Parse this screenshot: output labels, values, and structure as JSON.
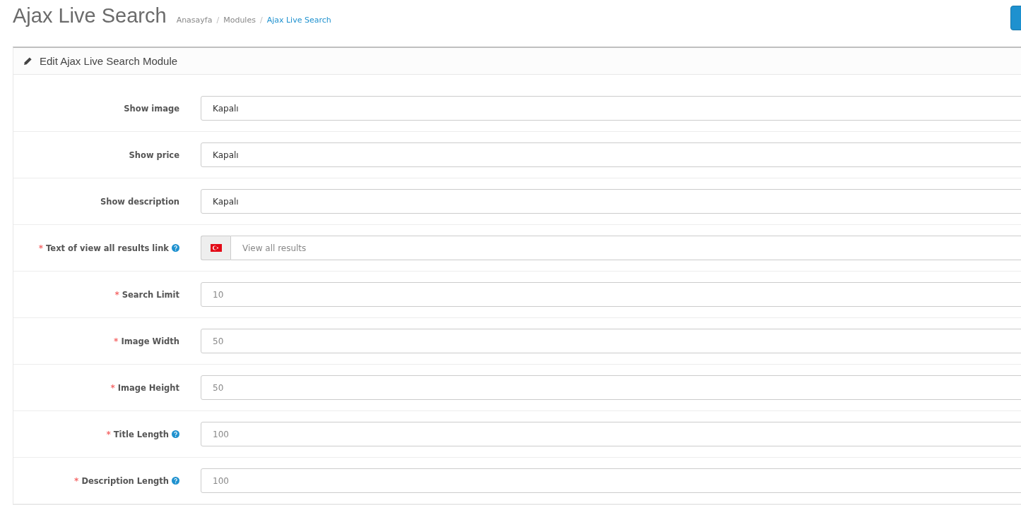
{
  "page": {
    "title": "Ajax Live Search",
    "breadcrumb": [
      {
        "label": "Anasayfa",
        "current": false
      },
      {
        "separator": "/",
        "label": "Modules",
        "current": false
      },
      {
        "separator": "/",
        "label": "Ajax Live Search",
        "current": true
      }
    ]
  },
  "panel": {
    "heading": "Edit Ajax Live Search Module",
    "fields": [
      {
        "kind": "select",
        "label": "Show image",
        "help": false,
        "value": "Kapalı"
      },
      {
        "kind": "select",
        "label": "Show price",
        "help": false,
        "value": "Kapalı"
      },
      {
        "kind": "select",
        "label": "Show description",
        "help": false,
        "value": "Kapalı"
      },
      {
        "kind": "language",
        "required_mark": "*",
        "label": "Text of view all results link",
        "help": true,
        "value": "View all results"
      },
      {
        "kind": "text",
        "required_mark": "*",
        "label": "Search Limit",
        "help": false,
        "value": "10"
      },
      {
        "kind": "text",
        "required_mark": "*",
        "label": "Image Width",
        "help": false,
        "value": "50"
      },
      {
        "kind": "text",
        "required_mark": "*",
        "label": "Image Height",
        "help": false,
        "value": "50"
      },
      {
        "kind": "text",
        "required_mark": "*",
        "label": "Title Length",
        "help": true,
        "value": "100"
      },
      {
        "kind": "text",
        "required_mark": "*",
        "label": "Description Length",
        "help": true,
        "value": "100"
      }
    ]
  }
}
